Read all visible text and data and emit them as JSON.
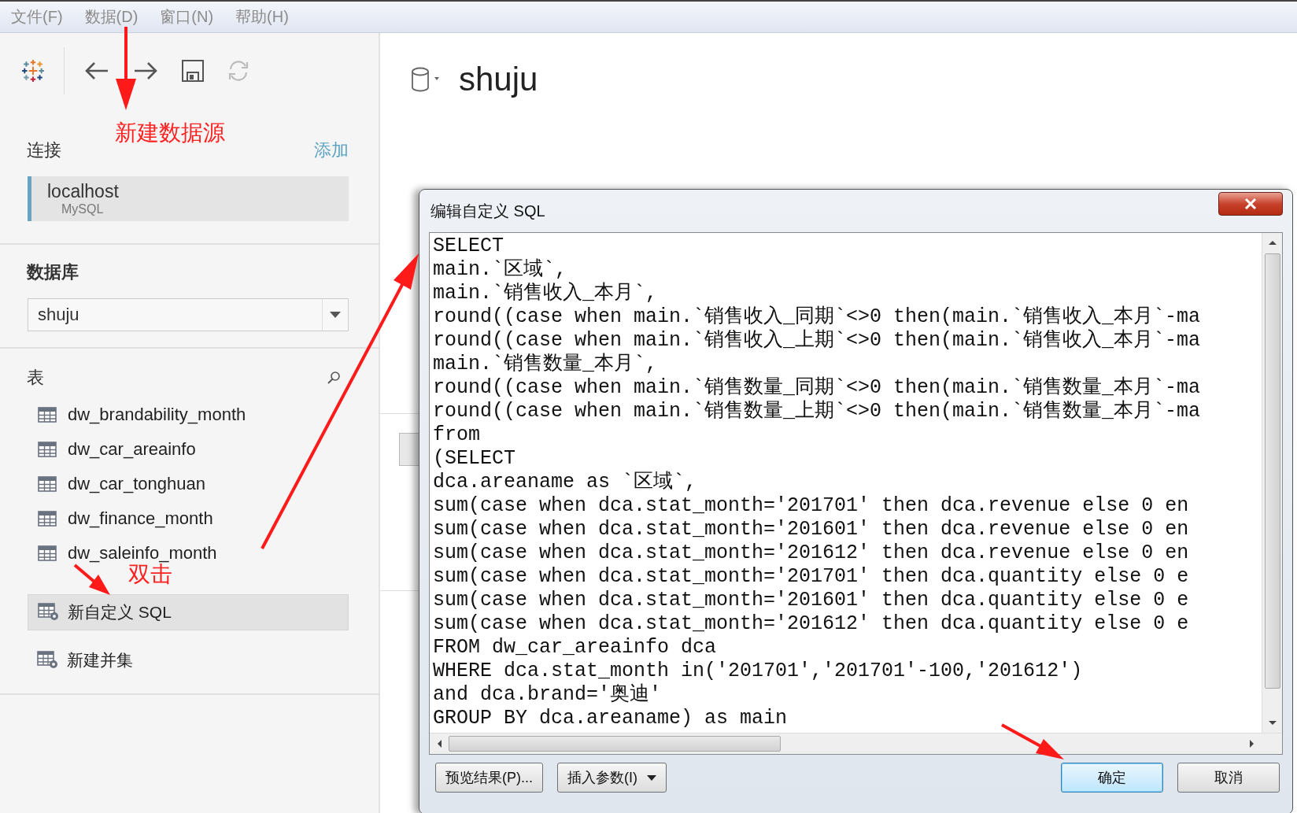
{
  "menu_bar": [
    "文件(F)",
    "数据(D)",
    "窗口(N)",
    "帮助(H)"
  ],
  "sidebar": {
    "connections_heading": "连接",
    "add_link": "添加",
    "connection": {
      "name": "localhost",
      "type": "MySQL",
      "selected": true
    },
    "database_heading": "数据库",
    "database_select": "shuju",
    "tables_heading": "表",
    "tables": [
      "dw_brandability_month",
      "dw_car_areainfo",
      "dw_car_tonghuan",
      "dw_finance_month",
      "dw_saleinfo_month"
    ],
    "actions": [
      {
        "label": "新自定义 SQL",
        "selected": true
      },
      {
        "label": "新建并集",
        "selected": false
      }
    ]
  },
  "data_source_title": "shuju",
  "dialog": {
    "title": "编辑自定义 SQL",
    "sql_lines": [
      "SELECT",
      "main.`区域`,",
      "main.`销售收入_本月`,",
      "round((case when main.`销售收入_同期`<>0 then(main.`销售收入_本月`-ma",
      "round((case when main.`销售收入_上期`<>0 then(main.`销售收入_本月`-ma",
      "main.`销售数量_本月`,",
      "round((case when main.`销售数量_同期`<>0 then(main.`销售数量_本月`-ma",
      "round((case when main.`销售数量_上期`<>0 then(main.`销售数量_本月`-ma",
      "from",
      "(SELECT",
      "dca.areaname as `区域`,",
      "sum(case when dca.stat_month='201701' then dca.revenue else 0 en",
      "sum(case when dca.stat_month='201601' then dca.revenue else 0 en",
      "sum(case when dca.stat_month='201612' then dca.revenue else 0 en",
      "sum(case when dca.stat_month='201701' then dca.quantity else 0 e",
      "sum(case when dca.stat_month='201601' then dca.quantity else 0 e",
      "sum(case when dca.stat_month='201612' then dca.quantity else 0 e",
      "FROM dw_car_areainfo dca",
      "WHERE dca.stat_month in('201701','201701'-100,'201612')",
      "and dca.brand='奥迪'",
      "GROUP BY dca.areaname) as main"
    ],
    "buttons": [
      {
        "label": "预览结果(P)...",
        "kind": "plain"
      },
      {
        "label": "插入参数(I)",
        "kind": "dropdown"
      },
      {
        "label": "确定",
        "kind": "default"
      },
      {
        "label": "取消",
        "kind": "plain"
      }
    ]
  },
  "annotations": [
    {
      "text": "新建数据源"
    },
    {
      "text": "双击"
    }
  ]
}
